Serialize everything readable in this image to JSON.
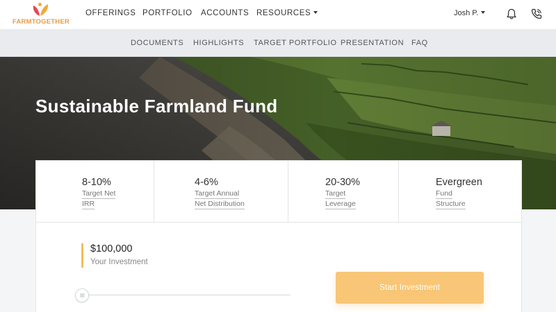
{
  "brand": {
    "name": "FARMTOGETHER",
    "text_color": "#e79e45",
    "leaf_colors": [
      "#e6485a",
      "#f2a93b"
    ]
  },
  "topnav": {
    "items": [
      {
        "label": "OFFERINGS"
      },
      {
        "label": "PORTFOLIO"
      },
      {
        "label": "ACCOUNTS"
      },
      {
        "label": "RESOURCES",
        "has_dropdown": true
      }
    ],
    "user": {
      "name": "Josh P.",
      "has_dropdown": true
    },
    "icons": [
      "bell-icon",
      "phone-icon"
    ]
  },
  "subnav": {
    "items": [
      {
        "label": "DOCUMENTS"
      },
      {
        "label": "HIGHLIGHTS"
      },
      {
        "label": "TARGET PORTFOLIO"
      },
      {
        "label": "PRESENTATION"
      },
      {
        "label": "FAQ"
      }
    ]
  },
  "hero": {
    "title": "Sustainable Farmland Fund"
  },
  "stats": [
    {
      "value": "8-10%",
      "label_lines": [
        "Target Net",
        "IRR"
      ]
    },
    {
      "value": "4-6%",
      "label_lines": [
        "Target Annual",
        "Net Distribution"
      ]
    },
    {
      "value": "20-30%",
      "label_lines": [
        "Target",
        "Leverage"
      ]
    },
    {
      "value": "Evergreen",
      "label_lines": [
        "Fund",
        "Structure"
      ]
    }
  ],
  "investment": {
    "amount": "$100,000",
    "label": "Your Investment",
    "slider_level": 0,
    "cta_label": "Start Investment",
    "accent_color": "#f3bc5b",
    "cta_color": "#f8c676"
  }
}
